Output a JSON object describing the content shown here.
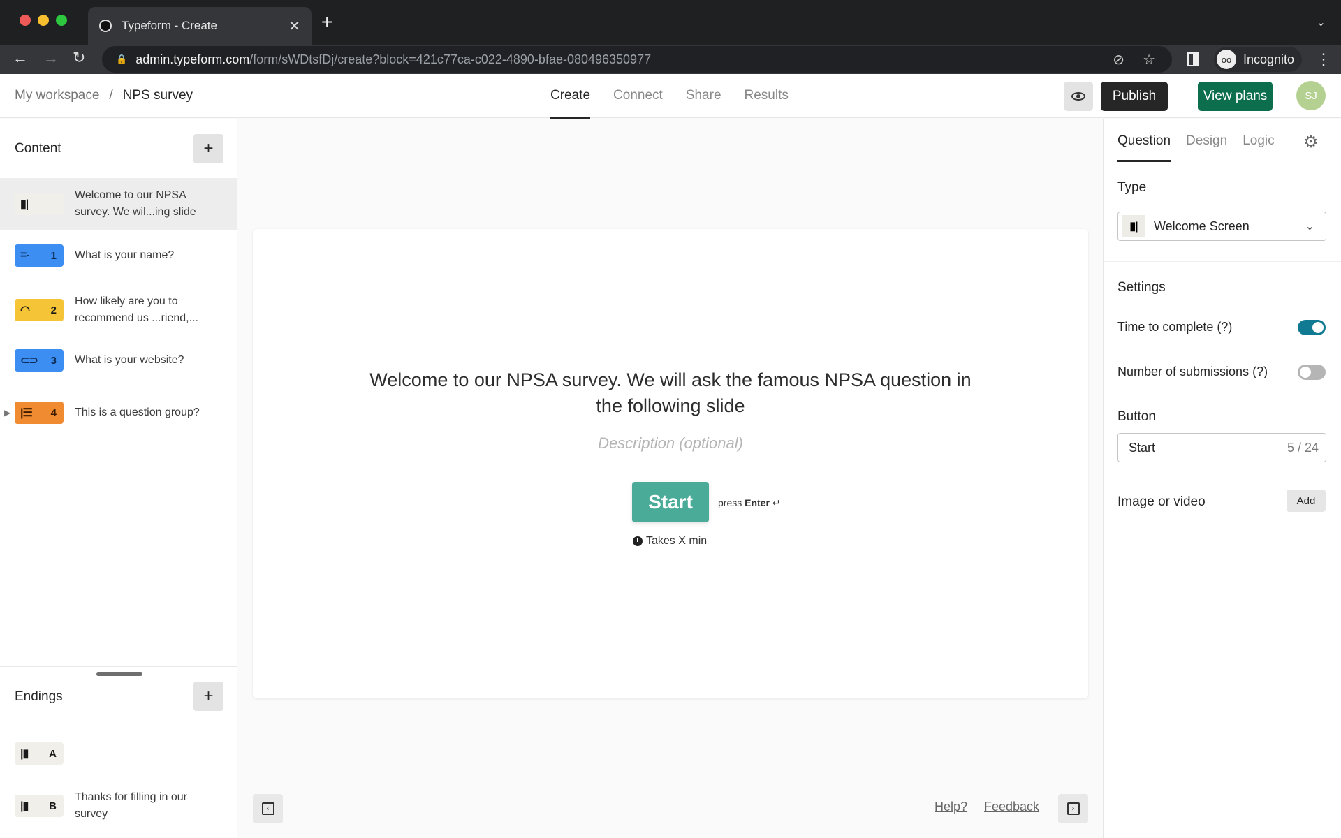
{
  "browser": {
    "tab_title": "Typeform - Create",
    "url_host": "admin.typeform.com",
    "url_path": "/form/sWDtsfDj/create?block=421c77ca-c022-4890-bfae-080496350977",
    "profile_label": "Incognito"
  },
  "header": {
    "breadcrumb": {
      "workspace": "My workspace",
      "separator": "/",
      "current": "NPS survey"
    },
    "tabs": [
      {
        "label": "Create",
        "active": true
      },
      {
        "label": "Connect",
        "active": false
      },
      {
        "label": "Share",
        "active": false
      },
      {
        "label": "Results",
        "active": false
      }
    ],
    "publish_label": "Publish",
    "view_plans_label": "View plans",
    "avatar_initials": "SJ",
    "colors": {
      "publish": "#262627",
      "view_plans": "#0d6e4e"
    }
  },
  "content_panel": {
    "title": "Content",
    "add_label": "+",
    "items": [
      {
        "type": "welcome",
        "icon": "welcome-screen-icon",
        "number": "",
        "text": "Welcome to our NPSA survey. We wil...ing slide",
        "selected": true,
        "color": "#f1efe9"
      },
      {
        "type": "short-text",
        "icon": "short-text-icon",
        "number": "1",
        "text": "What is your name?",
        "color": "#3d8ef2"
      },
      {
        "type": "nps",
        "icon": "gauge-icon",
        "number": "2",
        "text": "How likely are you to recommend us ...riend,...",
        "color": "#f5c437"
      },
      {
        "type": "website",
        "icon": "link-icon",
        "number": "3",
        "text": "What is your website?",
        "color": "#3d8ef2"
      },
      {
        "type": "group",
        "icon": "question-group-icon",
        "number": "4",
        "text": "This is a question group?",
        "color": "#f08b32",
        "collapsible": true
      }
    ]
  },
  "endings_panel": {
    "title": "Endings",
    "add_label": "+",
    "items": [
      {
        "icon": "ending-screen-icon",
        "letter": "A",
        "text": ""
      },
      {
        "icon": "ending-screen-icon",
        "letter": "B",
        "text": "Thanks for filling in our survey"
      }
    ]
  },
  "canvas": {
    "welcome_text": "Welcome to our NPSA survey. We will ask the famous NPSA question in the following slide",
    "description_placeholder": "Description (optional)",
    "start_label": "Start",
    "press_text": "press",
    "press_key": "Enter",
    "enter_glyph": "↵",
    "time_text": "Takes X min",
    "start_color": "#4aab99",
    "help_label": "Help?",
    "feedback_label": "Feedback"
  },
  "right_panel": {
    "tabs": [
      {
        "label": "Question",
        "active": true
      },
      {
        "label": "Design",
        "active": false
      },
      {
        "label": "Logic",
        "active": false
      }
    ],
    "type_label": "Type",
    "type_value": "Welcome Screen",
    "settings_label": "Settings",
    "settings": [
      {
        "label": "Time to complete (?)",
        "on": true
      },
      {
        "label": "Number of submissions (?)",
        "on": false
      }
    ],
    "button_label": "Button",
    "button_value": "Start",
    "button_count": "5 / 24",
    "image_label": "Image or video",
    "image_add_label": "Add",
    "toggle_on_color": "#117a93"
  }
}
